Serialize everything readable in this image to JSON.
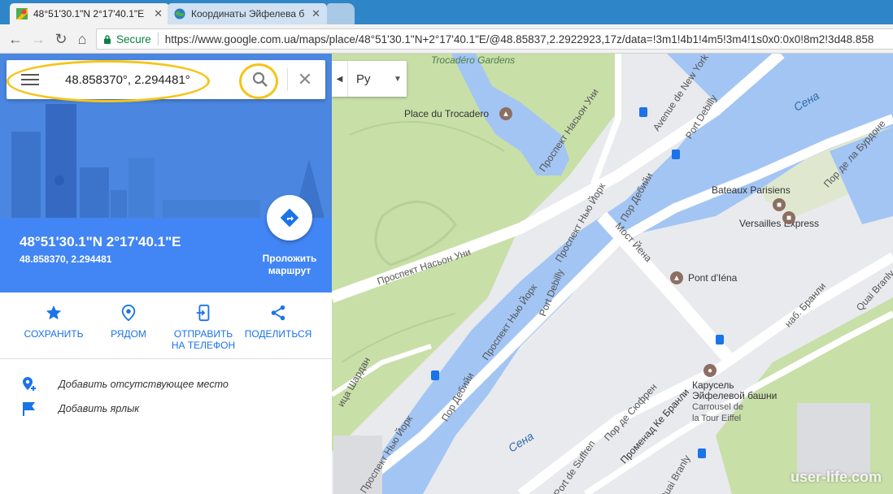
{
  "browser": {
    "tabs": [
      {
        "title": "48°51'30.1\"N 2°17'40.1\"E",
        "active": true
      },
      {
        "title": "Координаты Эйфелева б",
        "active": false
      }
    ],
    "secure_label": "Secure",
    "url": "https://www.google.com.ua/maps/place/48°51'30.1\"N+2°17'40.1\"E/@48.85837,2.2922923,17z/data=!3m1!4b1!4m5!3m4!1s0x0:0x0!8m2!3d48.858"
  },
  "search": {
    "value": "48.858370°, 2.294481°"
  },
  "place": {
    "dms": "48°51'30.1\"N 2°17'40.1\"E",
    "decimal": "48.858370, 2.294481",
    "route_label": "Проложить маршрут"
  },
  "actions": [
    {
      "label": "СОХРАНИТЬ",
      "icon": "star-icon"
    },
    {
      "label": "РЯДОМ",
      "icon": "nearby-icon"
    },
    {
      "label": "ОТПРАВИТЬ НА ТЕЛЕФОН",
      "icon": "send-to-phone-icon"
    },
    {
      "label": "ПОДЕЛИТЬСЯ",
      "icon": "share-icon"
    }
  ],
  "extra": [
    {
      "label": "Добавить отсутствующее место",
      "icon": "add-place-icon"
    },
    {
      "label": "Добавить ярлык",
      "icon": "flag-icon"
    }
  ],
  "map": {
    "language": "Ру",
    "labels": {
      "trocadero_gardens": "Trocadéro Gardens",
      "place_trocadero": "Place du Trocadero",
      "prosp_nasson_uni_top": "Проспект Насьон Уни",
      "prosp_nasson_uni_mid": "Проспект Насьон Уни",
      "avenue_new_york": "Avenue de New York",
      "port_debilly_top": "Port Debilly",
      "port_debilly_mid": "Port Debilly",
      "prosp_nu_york_top": "Проспект Нью Йорк",
      "prosp_nu_york_mid": "Проспект Нью Йорк",
      "prosp_nu_york_low": "Проспект Нью Йорк",
      "por_debiyi_top": "Пор Дебийи",
      "por_debiyi_low": "Пор Дебийи",
      "most_iena": "Мост Йена",
      "pont_iena": "Pont d'Iéna",
      "sena_top": "Сена",
      "sena_bottom": "Сена",
      "bateaux": "Bateaux Parisiens",
      "versailles": "Versailles Express",
      "por_de_la_burdone": "Пор де ла Бурдоне",
      "nab_branli": "наб. Бранли",
      "quai_branly_top": "Quai Branly",
      "quai_branly_bottom": "Quai Branly",
      "carousel_ru_1": "Карусель",
      "carousel_ru_2": "Эйфелевой башни",
      "carousel_fr_1": "Carrousel de",
      "carousel_fr_2": "la Tour Eiffel",
      "por_de_syufren": "Пор де Сюфрен",
      "port_de_suffren": "Port de Suffren",
      "promenad": "Променад Ке Бранли",
      "ul_shardan": "ица Шардан"
    },
    "watermark": "user-life.com"
  },
  "colors": {
    "water": "#a3c5f3",
    "park": "#c8dfa8",
    "road": "#ffffff",
    "land": "#e8eaed",
    "accent_blue": "#4285f4",
    "highlight_yellow": "#f5c518",
    "pin_red": "#ea4335"
  }
}
